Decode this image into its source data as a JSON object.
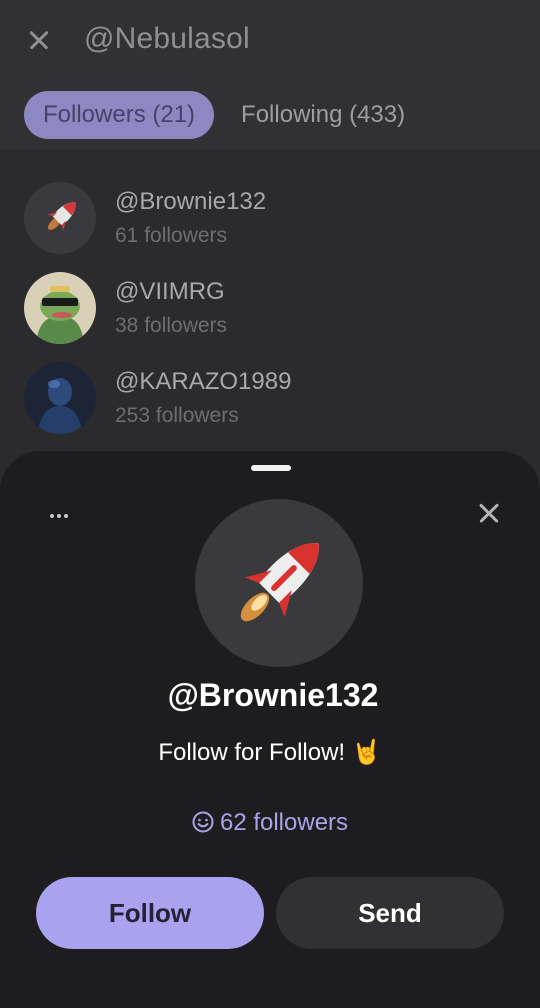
{
  "header": {
    "title": "@Nebulasol",
    "tabs": [
      {
        "label": "Followers (21)",
        "active": true
      },
      {
        "label": "Following (433)",
        "active": false
      }
    ]
  },
  "list": [
    {
      "name": "@Brownie132",
      "followers": "61 followers",
      "avatar_icon": "rocket-icon"
    },
    {
      "name": "@VIIMRG",
      "followers": "38 followers",
      "avatar_icon": "frog-sunglasses-icon"
    },
    {
      "name": "@KARAZO1989",
      "followers": "253 followers",
      "avatar_icon": "dark-blue-figure-icon"
    }
  ],
  "sheet": {
    "name": "@Brownie132",
    "bio": "Follow for Follow! 🤘",
    "followers": "62 followers",
    "follow_label": "Follow",
    "send_label": "Send"
  },
  "colors": {
    "accent": "#a9a2ee",
    "tab_active_bg": "#8d87c2",
    "sheet_bg": "#1d1d1f"
  }
}
